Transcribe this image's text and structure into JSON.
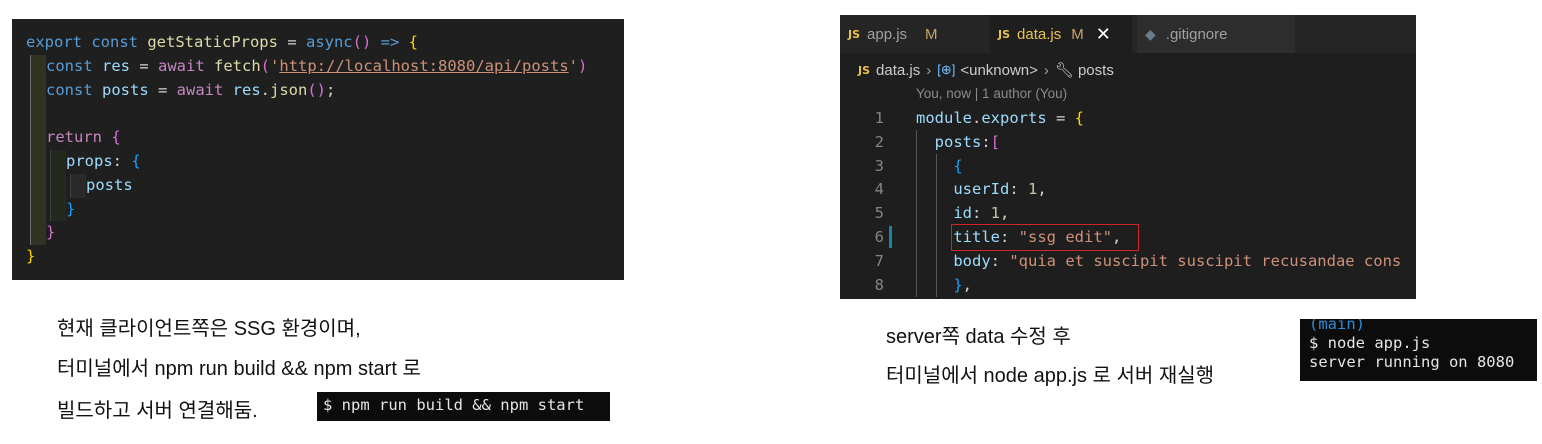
{
  "left_code": {
    "lines": [
      [
        {
          "t": "export ",
          "c": "kw"
        },
        {
          "t": "const ",
          "c": "kw"
        },
        {
          "t": "getStaticProps",
          "c": "fn"
        },
        {
          "t": " = ",
          "c": "op"
        },
        {
          "t": "async",
          "c": "kw"
        },
        {
          "t": "()",
          "c": "b2"
        },
        {
          "t": " => ",
          "c": "kw"
        },
        {
          "t": "{",
          "c": "b1"
        }
      ],
      [
        {
          "t": "const ",
          "c": "kw"
        },
        {
          "t": "res",
          "c": "var"
        },
        {
          "t": " = ",
          "c": "op"
        },
        {
          "t": "await ",
          "c": "kw2"
        },
        {
          "t": "fetch",
          "c": "fn"
        },
        {
          "t": "(",
          "c": "b2"
        },
        {
          "t": "'",
          "c": "str"
        },
        {
          "t": "http://localhost:8080/api/posts",
          "c": "str url"
        },
        {
          "t": "'",
          "c": "str"
        },
        {
          "t": ")",
          "c": "b2"
        }
      ],
      [
        {
          "t": "const ",
          "c": "kw"
        },
        {
          "t": "posts",
          "c": "var"
        },
        {
          "t": " = ",
          "c": "op"
        },
        {
          "t": "await ",
          "c": "kw2"
        },
        {
          "t": "res",
          "c": "var"
        },
        {
          "t": ".",
          "c": "op"
        },
        {
          "t": "json",
          "c": "fn"
        },
        {
          "t": "()",
          "c": "b2"
        },
        {
          "t": ";",
          "c": "op"
        }
      ],
      [],
      [
        {
          "t": "return ",
          "c": "kw2"
        },
        {
          "t": "{",
          "c": "b2"
        }
      ],
      [
        {
          "t": "props",
          "c": "var"
        },
        {
          "t": ": ",
          "c": "op"
        },
        {
          "t": "{",
          "c": "b3"
        }
      ],
      [
        {
          "t": "posts",
          "c": "var"
        }
      ],
      [
        {
          "t": "}",
          "c": "b3"
        }
      ],
      [
        {
          "t": "}",
          "c": "b2"
        }
      ],
      [
        {
          "t": "}",
          "c": "b1"
        }
      ]
    ]
  },
  "editor": {
    "tabs": [
      {
        "label": "app.js",
        "icon": "JS",
        "status": "M"
      },
      {
        "label": "data.js",
        "icon": "JS",
        "status": "M",
        "close": "✕"
      },
      {
        "label": ".gitignore",
        "icon": "◆"
      }
    ],
    "breadcrumb": {
      "file": "data.js",
      "symbol1": "<unknown>",
      "symbol2": "posts"
    },
    "blame": "You, now | 1 author (You)",
    "lines": [
      {
        "n": "1",
        "tokens": [
          {
            "t": "module",
            "c": "var"
          },
          {
            "t": ".",
            "c": "op"
          },
          {
            "t": "exports",
            "c": "var"
          },
          {
            "t": " = ",
            "c": "op"
          },
          {
            "t": "{",
            "c": "b1"
          }
        ]
      },
      {
        "n": "2",
        "tokens": [
          {
            "t": "  posts",
            "c": "var"
          },
          {
            "t": ":",
            "c": "op"
          },
          {
            "t": "[",
            "c": "b2"
          }
        ]
      },
      {
        "n": "3",
        "tokens": [
          {
            "t": "    {",
            "c": "b3"
          }
        ]
      },
      {
        "n": "4",
        "tokens": [
          {
            "t": "    userId",
            "c": "var"
          },
          {
            "t": ": ",
            "c": "op"
          },
          {
            "t": "1",
            "c": "num"
          },
          {
            "t": ",",
            "c": "op"
          }
        ]
      },
      {
        "n": "5",
        "tokens": [
          {
            "t": "    id",
            "c": "var"
          },
          {
            "t": ": ",
            "c": "op"
          },
          {
            "t": "1",
            "c": "num"
          },
          {
            "t": ",",
            "c": "op"
          }
        ]
      },
      {
        "n": "6",
        "tokens": [
          {
            "t": "    title",
            "c": "var"
          },
          {
            "t": ": ",
            "c": "op"
          },
          {
            "t": "\"ssg edit\"",
            "c": "str"
          },
          {
            "t": ",",
            "c": "op"
          }
        ]
      },
      {
        "n": "7",
        "tokens": [
          {
            "t": "    body",
            "c": "var"
          },
          {
            "t": ": ",
            "c": "op"
          },
          {
            "t": "\"quia et suscipit suscipit recusandae cons",
            "c": "str"
          }
        ]
      },
      {
        "n": "8",
        "tokens": [
          {
            "t": "    }",
            "c": "b3"
          },
          {
            "t": ",",
            "c": "op"
          }
        ]
      }
    ]
  },
  "captions": {
    "left_1": "현재 클라이언트쪽은 SSG 환경이며,",
    "left_2": "터미널에서 npm run build && npm start 로",
    "left_3": "빌드하고 서버 연결해둠.",
    "right_1": "server쪽 data 수정 후",
    "right_2": "터미널에서 node app.js 로 서버 재실행"
  },
  "terminal_left": {
    "command": "$ npm run build && npm start"
  },
  "terminal_right": {
    "branch": "(main)",
    "command": "$ node app.js",
    "output": "server running on 8080"
  }
}
